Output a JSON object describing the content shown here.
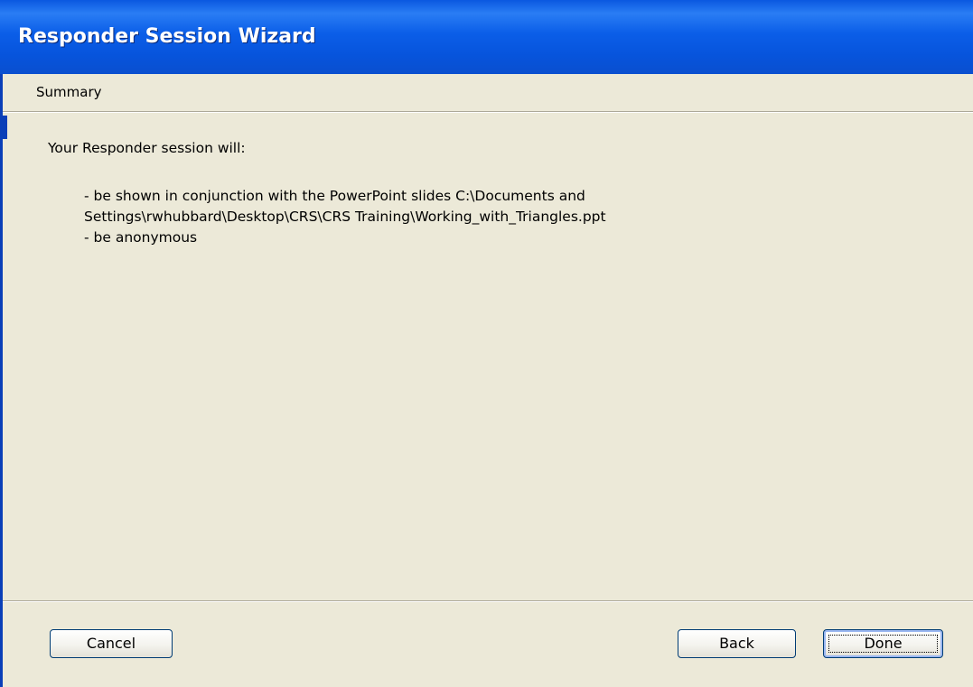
{
  "window": {
    "title": "Responder Session Wizard"
  },
  "header": {
    "step_title": "Summary"
  },
  "content": {
    "intro": "Your Responder session will:",
    "details": [
      "- be shown in conjunction with the PowerPoint slides C:\\Documents and",
      "Settings\\rwhubbard\\Desktop\\CRS\\CRS Training\\Working_with_Triangles.ppt",
      "- be anonymous"
    ]
  },
  "buttons": {
    "cancel": "Cancel",
    "back": "Back",
    "done": "Done"
  },
  "colors": {
    "titlebar": "#0a58e0",
    "dialog_background": "#ece9d8",
    "button_border": "#003c74"
  }
}
